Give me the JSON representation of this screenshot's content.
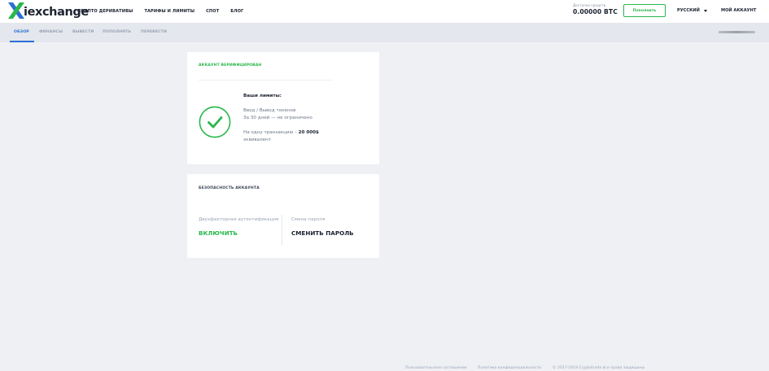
{
  "brand": {
    "logo_letter": "X",
    "logo_text": "iexchange"
  },
  "topnav": {
    "items": [
      "КРИПТО ДЕРИВАТИВЫ",
      "ТАРИФЫ И ЛИМИТЫ",
      "СПОТ",
      "БЛОГ"
    ]
  },
  "balance": {
    "label": "Доступно средств",
    "value": "0.00000 BTC"
  },
  "header": {
    "deposit_label": "Пополнить",
    "language": "РУССКИЙ",
    "account_label": "МОЙ АККАУНТ"
  },
  "subnav": {
    "tabs": [
      "ОБЗОР",
      "ФИНАНСЫ",
      "ВЫВЕСТИ",
      "ПОПОЛНИТЬ",
      "ПЕРЕВЕСТИ"
    ],
    "active": "ОБЗОР"
  },
  "verification": {
    "title": "АККАУНТ ВЕРИФИЦИРОВАН",
    "limits_title": "Ваши лимиты:",
    "line1": "Ввод / Вывод токенов",
    "line2": "За 30 дней — не ограничено",
    "line3_prefix": "На одну транзакцию – ",
    "line3_amount": "20 000$",
    "line4": "эквивалент"
  },
  "security": {
    "title": "БЕЗОПАСНОСТЬ АККАУНТА",
    "twofa_label": "Двухфакторная аутентификация",
    "twofa_action": "ВКЛЮЧИТЬ",
    "password_label": "Смена пароля",
    "password_action": "СМЕНИТЬ ПАРОЛЬ"
  },
  "footer": {
    "links": [
      "Пользовательское соглашение",
      "Политика конфиденциальности"
    ],
    "copyright": "© 2017-2019 Cryptotrade все права защищены"
  },
  "colors": {
    "accent_green": "#28b74b",
    "accent_blue": "#2b6fd6",
    "text_dark": "#1d2331"
  },
  "icons": [
    "x-logo-icon",
    "chevron-down-icon",
    "check-circle-icon"
  ]
}
